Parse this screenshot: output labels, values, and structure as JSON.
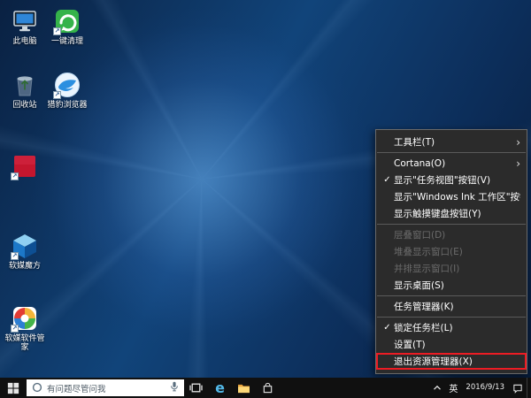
{
  "desktop": {
    "icons": [
      {
        "label": "此电脑"
      },
      {
        "label": "一键清理"
      },
      {
        "label": "回收站"
      },
      {
        "label": "猎豹浏览器"
      },
      {
        "label": ""
      },
      {
        "label": "软媒魔方"
      },
      {
        "label": "软媒软件管家"
      }
    ]
  },
  "context_menu": {
    "items": [
      {
        "label": "工具栏(T)",
        "submenu": true
      },
      {
        "label": "Cortana(O)",
        "submenu": true
      },
      {
        "label": "显示\"任务视图\"按钮(V)",
        "checked": true
      },
      {
        "label": "显示\"Windows Ink 工作区\"按钮(W)"
      },
      {
        "label": "显示触摸键盘按钮(Y)"
      },
      {
        "label": "层叠窗口(D)",
        "disabled": true
      },
      {
        "label": "堆叠显示窗口(E)",
        "disabled": true
      },
      {
        "label": "并排显示窗口(I)",
        "disabled": true
      },
      {
        "label": "显示桌面(S)"
      },
      {
        "label": "任务管理器(K)"
      },
      {
        "label": "锁定任务栏(L)",
        "checked": true
      },
      {
        "label": "设置(T)"
      },
      {
        "label": "退出资源管理器(X)",
        "annotated": true
      }
    ]
  },
  "taskbar": {
    "search_placeholder": "有问题尽管问我",
    "tray": {
      "ime": "英",
      "date": "2016/9/13"
    }
  },
  "glyphs": {
    "checkmark": "✓",
    "submenu_arrow": "›",
    "shortcut_arrow": "↗",
    "edge_letter": "e"
  },
  "colors": {
    "annotation_red": "#ec1c24",
    "menu_bg": "#2b2b2b",
    "taskbar_bg": "#101010",
    "wallpaper_accent": "#11447a"
  }
}
